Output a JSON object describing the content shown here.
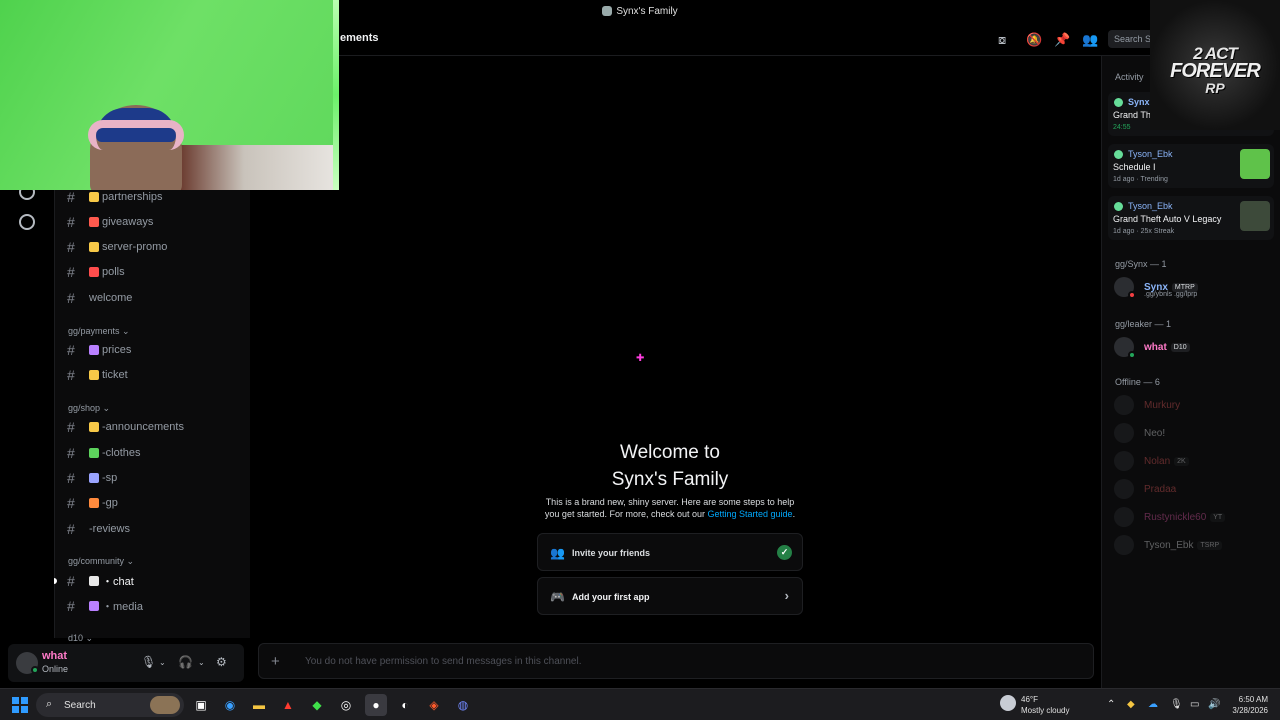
{
  "window": {
    "title": "Synx's Family"
  },
  "header": {
    "channel_name": "ements",
    "search_placeholder": "Search S"
  },
  "channels": [
    {
      "name": "partnerships",
      "emoji_color": "#f7c948"
    },
    {
      "name": "giveaways",
      "emoji_color": "#ff5a4e"
    },
    {
      "name": "server-promo",
      "emoji_color": "#f7c948"
    },
    {
      "name": "polls",
      "emoji_color": "#ff4d4d"
    },
    {
      "name": "welcome",
      "emoji_color": ""
    }
  ],
  "categories": {
    "payments": "gg/payments",
    "shop": "gg/shop",
    "community": "gg/community",
    "d10": "d10"
  },
  "payments_channels": [
    {
      "name": "prices",
      "emoji_color": "#b980ff"
    },
    {
      "name": "ticket",
      "emoji_color": "#f7c948"
    }
  ],
  "shop_channels": [
    {
      "name": "-announcements",
      "emoji_color": "#f7c948"
    },
    {
      "name": "-clothes",
      "emoji_color": "#5dd35d"
    },
    {
      "name": "-sp",
      "emoji_color": "#9aa4ff"
    },
    {
      "name": "-gp",
      "emoji_color": "#ff8a3d"
    },
    {
      "name": "-reviews",
      "emoji_color": ""
    }
  ],
  "community_channels": [
    {
      "name": "・chat",
      "emoji_color": "#e8e8e8",
      "active": true
    },
    {
      "name": "・media",
      "emoji_color": "#b980ff"
    }
  ],
  "user": {
    "name": "what",
    "status": "Online"
  },
  "welcome": {
    "title_line1": "Welcome to",
    "title_line2": "Synx's Family",
    "desc_prefix": "This is a brand new, shiny server. Here are some steps to help you get started. For more, check out our ",
    "desc_link": "Getting Started guide",
    "desc_suffix": "."
  },
  "steps": [
    {
      "label": "Invite your friends",
      "completed": true
    },
    {
      "label": "Add your first app",
      "completed": false
    }
  ],
  "composer": {
    "placeholder": "You do not have permission to send messages in this channel."
  },
  "members": {
    "activity_label": "Activity",
    "activity_cards": [
      {
        "user": "Synx",
        "game": "Grand Th",
        "meta": "24:55"
      },
      {
        "user": "Tyson_Ebk",
        "game": "Schedule I",
        "meta": "1d ago · Trending",
        "art_color": "#5fc24a"
      },
      {
        "user": "Tyson_Ebk",
        "game": "Grand Theft Auto V Legacy",
        "meta": "1d ago · 25x Streak",
        "art_color": "#3d4a3a"
      }
    ],
    "group_synx": "gg/Synx — 1",
    "synx_member": {
      "name": "Synx",
      "tag": "MTRP",
      "sub": ".gg/ybnls .gg/lprp"
    },
    "group_leaker": "gg/leaker — 1",
    "leaker_member": {
      "name": "what",
      "tag": "D10"
    },
    "offline_label": "Offline — 6",
    "offline_members": [
      {
        "name": "Murkury",
        "color": "#e05a5a"
      },
      {
        "name": "Neo!",
        "color": "#dbdee1"
      },
      {
        "name": "Nolan",
        "color": "#e05a5a",
        "tag": "2K"
      },
      {
        "name": "Pradaa",
        "color": "#e05a5a"
      },
      {
        "name": "Rustynickle60",
        "color": "#e05aa8",
        "tag": "YT"
      },
      {
        "name": "Tyson_Ebk",
        "color": "#dbdee1",
        "tag": "TSRP"
      }
    ]
  },
  "stream_overlay": {
    "logo_line1": "2 ACT",
    "logo_line2": "FOREVER",
    "logo_line3": "RP"
  },
  "taskbar": {
    "search_label": "Search",
    "weather_temp": "46°F",
    "weather_desc": "Mostly cloudy",
    "time": "6:50 AM",
    "date": "3/28/2026",
    "weather_badge": "2"
  }
}
